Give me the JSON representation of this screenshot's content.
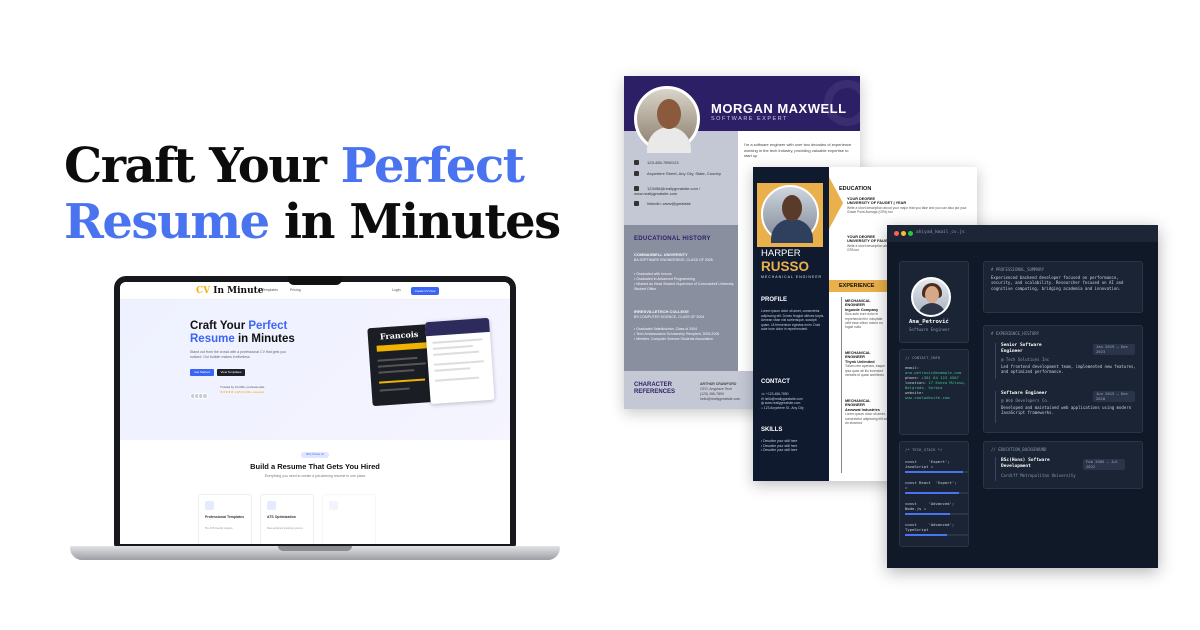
{
  "headline": {
    "line1_part1": "Craft Your ",
    "line1_part2": "Perfect",
    "line2_part1": "Resume",
    "line2_part2": " in Minutes",
    "accent_color": "#4a73f0"
  },
  "laptop": {
    "logo_cv": "CV",
    "logo_rest": " In Minute",
    "nav_links": [
      "Templates",
      "Pricing"
    ],
    "nav_login": "Login",
    "nav_cta": "Create CV Now",
    "hero_title_1": "Craft Your ",
    "hero_title_2": "Perfect",
    "hero_title_3": "Resume",
    "hero_title_4": " in Minutes",
    "hero_sub": "Stand out from the crowd with a professional CV that gets you noticed. Our builder makes it effortless.",
    "btn_primary": "Get Started",
    "btn_secondary": "View Templates",
    "trust_text": "Trusted by 10,000+ professionals",
    "stars": "★★★★★ 4.9/5 (2,000+ reviews)",
    "preview_name": "Francois",
    "badge": "Why Choose Us",
    "section_title": "Build a Resume That Gets You Hired",
    "section_sub": "Everything you need to create a job-winning resume in one place",
    "features": [
      {
        "title": "Professional Templates",
        "desc": "50+ ATS-friendly designs"
      },
      {
        "title": "ATS Optimization",
        "desc": "Pass applicant tracking systems"
      },
      {
        "title": "",
        "desc": ""
      }
    ],
    "brand_color": "#3b66f5"
  },
  "resume_morgan": {
    "name": "MORGAN MAXWELL",
    "title": "SOFTWARE EXPERT",
    "about": "I'm a software engineer with over two decades of experience working in the tech industry, providing valuable expertise to start up",
    "contacts": [
      "123-456-7890123",
      "Anywhere Street, Any City, State, Country",
      "123456@reallygreatsite.com / www.reallygreatsite.com",
      "linkedin: www@greatsite"
    ],
    "edu_title": "EDUCATIONAL HISTORY",
    "edu1_school": "COMMASBELL UNIVERSITY",
    "edu1_degree": "BA SOFTWARE ENGINEERING, CLASS OF 2005",
    "edu1_points": [
      "Graduated with honors",
      "Graduated in Advanced Programming",
      "Worked as Head Student Supervisor of Commasbell University Student Office"
    ],
    "edu2_school": "IRRESVILLETECH COLLEGE",
    "edu2_degree": "BS COMPUTER SCIENCE, CLASS OF 2004",
    "edu2_points": [
      "Graduated Valedictorian, Class of 2004",
      "Tech Ambassadors Scholarship Recipient, 2005-2006",
      "Member, Computer Science Students Association"
    ],
    "ref_title": "CHARACTER REFERENCES",
    "ref_name": "ARTHUR CRAWFORD",
    "ref_details": [
      "CEO, Anyplace Tech",
      "(123) 456-7890",
      "hello@reallygreatsite.com"
    ],
    "header_color": "#2c1f66"
  },
  "resume_harper": {
    "first_name": "HARPER",
    "last_name": "RUSSO",
    "role": "MECHANICAL ENGINEER",
    "education_label": "EDUCATION",
    "edu_items": [
      {
        "degree": "YOUR DEGREE",
        "school": "UNIVERSITY OF FAUGET | YEAR",
        "desc": "Write a short description about your major that you take and you can also put your Grade Point Average (GPA) too"
      },
      {
        "degree": "YOUR DEGREE",
        "school": "UNIVERSITY OF FAUGET",
        "desc": "Write a short description about your major that you take and you can also put your GPA too"
      }
    ],
    "experience_label": "EXPERIENCE",
    "exp_items": [
      {
        "title": "MECHANICAL ENGINEER",
        "company": "Ingoude Company",
        "desc": "Duis aute irure dolor in reprehenderit in voluptate velit esse cillum dolore eu fugiat nulla"
      },
      {
        "title": "MECHANICAL ENGINEER",
        "company": "Thynk Unlimited",
        "desc": "Tollam rem aperiam, eaque ipsa quae ab illo inventore veritatis et quasi architecto"
      },
      {
        "title": "MECHANICAL ENGINEER",
        "company": "Arowwai Industries",
        "desc": "Lorem ipsum dolor sit amet, consectetur adipiscing elit sed do eiusmod"
      }
    ],
    "profile_label": "PROFILE",
    "profile_text": "Lorem ipsum dolor sit amet, consectetur adipiscing elit. Donec feugiat ultrices turpis. Aenean vitae nisl scelerisque, suscipit quam. Ut fermentum egestas enim. Duis aute irure dolor in reprehenderit.",
    "contact_label": "CONTACT",
    "contacts": [
      "+123-456-7890",
      "hello@reallygreatsite.com",
      "www.reallygreatsite.com",
      "123 Anywhere St., Any City"
    ],
    "skills_label": "SKILLS",
    "skills": [
      "Describe your skill here",
      "Describe your skill here",
      "Describe your skill here"
    ],
    "accent_color": "#eab04c"
  },
  "resume_terminal": {
    "filename": "ahiyad_kmail_cv.js",
    "name": "Ana_Petrović",
    "role": "Software Engineer",
    "contact_comment": "// CONTACT_INFO",
    "email_label": "email:",
    "email": "ana.petrovic@example.com",
    "phone_label": "phone:",
    "phone": "+381 64 123 4567",
    "location_label": "location:",
    "location": "17 Kneza Milosa, Belgrade, Serbia",
    "website_label": "website:",
    "website": "www.coolwebsite.com",
    "stack_comment": "/* TECH_STACK */",
    "stack": [
      {
        "line1": "const     'Expert';",
        "line2": "JavaScript =",
        "level": 0.9
      },
      {
        "line1": "const React  'Expert';",
        "line2": "=",
        "level": 0.85
      },
      {
        "line1": "const     'Advanced';",
        "line2": "Node.js =",
        "level": 0.7
      },
      {
        "line1": "const     'Advanced';",
        "line2": "TypeScript",
        "level": 0.65
      }
    ],
    "summary_comment": "# PROFESSIONAL_SUMMARY",
    "summary": "Experienced backend developer focused on performance, security, and scalability. Researcher focused on AI and cognitive computing, bridging academia and innovation.",
    "exp_comment": "# EXPERIENCE_HISTORY",
    "jobs": [
      {
        "title": "Senior Software Engineer",
        "company": "@ Tech Solutions Inc",
        "dates": "Jan 2019 – Dec 2023",
        "desc": "Led frontend development team, implemented new features, and optimized performance."
      },
      {
        "title": "Software Engineer",
        "company": "@ Web Developers Co.",
        "dates": "Jun 2015 – Dec 2018",
        "desc": "Developed and maintained web applications using modern JavaScript frameworks."
      }
    ],
    "edu_comment": "// EDUCATION_BACKGROUND",
    "degree": "BSc(Hons) Software Development",
    "degree_dates": "Feb 2005 – Jul 2022",
    "university": "Cardiff Metropolitan University",
    "accent_green": "#42c48a",
    "accent_blue": "#4a73f0"
  }
}
